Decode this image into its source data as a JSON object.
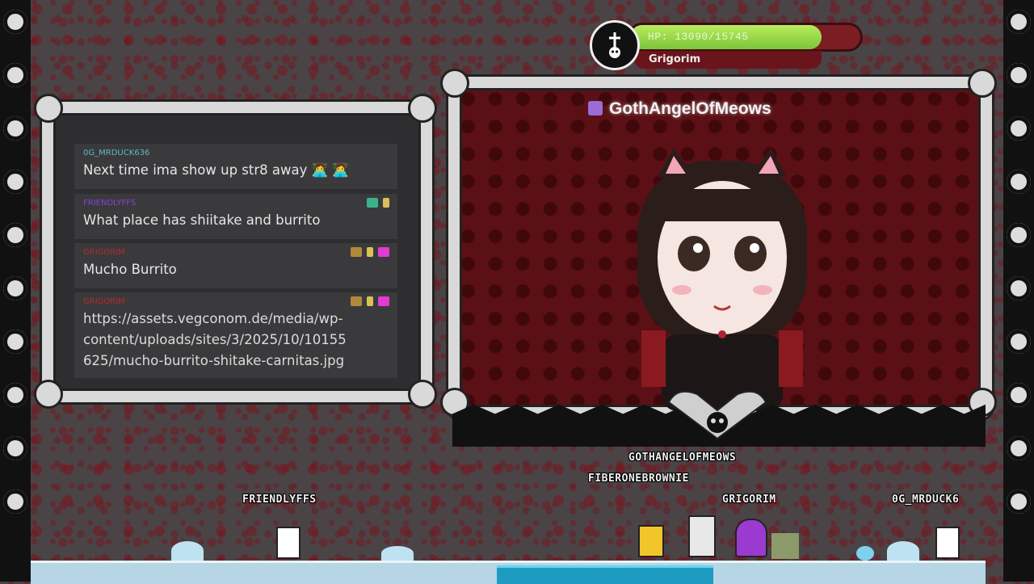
{
  "hud": {
    "hp_text": "HP: 13090/15745",
    "hp_fraction": 0.831,
    "player_name": "Grigorim",
    "icon": "ankh-skull-icon"
  },
  "stream": {
    "channel": "GothAngelOfMeows",
    "platform_icon": "twitch-icon"
  },
  "chat": {
    "messages": [
      {
        "user": "0G_MRDUCK636",
        "user_color": "#5fb8c6",
        "text": "Next time ima show up str8 away 👩‍💻 👩‍💻",
        "badges": []
      },
      {
        "user": "FRIENDLYFFS",
        "user_color": "#8a3fe0",
        "text": "What place has shiitake and burrito",
        "badges": [
          "#3bb28a",
          "#d9c15a"
        ]
      },
      {
        "user": "GRIGORIM",
        "user_color": "#b52a2a",
        "text": "Mucho Burrito",
        "badges": [
          "#b08a3a",
          "#d9c15a",
          "#e23bd2"
        ]
      },
      {
        "user": "GRIGORIM",
        "user_color": "#b52a2a",
        "text_lines": [
          "https://assets.vegconom.de/media/wp-",
          "content/uploads/sites/3/2025/10/10155",
          "625/mucho-burrito-shitake-carnitas.jpg"
        ],
        "badges": [
          "#b08a3a",
          "#d9c15a",
          "#e23bd2"
        ]
      }
    ]
  },
  "game": {
    "players": [
      {
        "name": "GOTHANGELOFMEOWS"
      },
      {
        "name": "FIBERONEBROWNIE"
      },
      {
        "name": "FRIENDLYFFS"
      },
      {
        "name": "GRIGORIM"
      },
      {
        "name": "0G_MRDUCK6"
      }
    ]
  }
}
